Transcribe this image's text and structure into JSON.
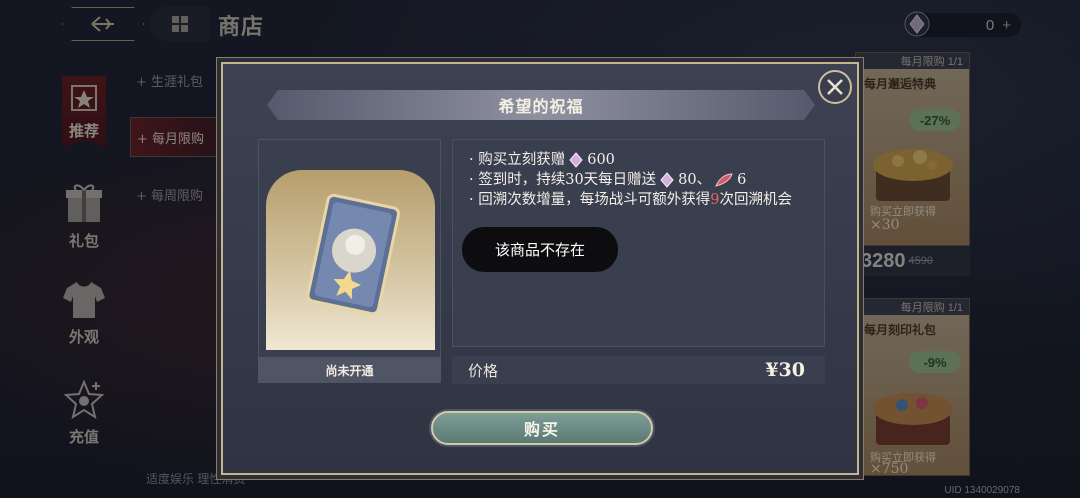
{
  "header": {
    "title": "商店",
    "currency_value": "0",
    "currency_plus": "+"
  },
  "nav": [
    {
      "label": "推荐"
    },
    {
      "label": "礼包"
    },
    {
      "label": "外观"
    },
    {
      "label": "充值"
    }
  ],
  "sub_tabs": [
    {
      "label": "+ 生涯礼包"
    },
    {
      "label": "+ 每月限购"
    },
    {
      "label": "+ 每周限购"
    }
  ],
  "products": [
    {
      "limit": "每月限购 1/1",
      "name": "每月邂逅特典",
      "discount": "-27%",
      "caption": "购买立即获得",
      "count": "×30",
      "price": "3280",
      "old_price": "4590"
    },
    {
      "limit": "每月限购 1/1",
      "name": "每月刻印礼包",
      "discount": "-9%",
      "caption": "购买立即获得",
      "count": "×750"
    }
  ],
  "footer_text": "适度娱乐 理性消费",
  "uid": "UID 1340029078",
  "modal": {
    "title": "希望的祝福",
    "card_status": "尚未开通",
    "desc": {
      "line1_a": "· 购买立刻获赠",
      "line1_b": "600",
      "line2_a": "· 签到时，持续30天每日赠送",
      "line2_b": "80、",
      "line2_c": "6",
      "line3_a": "· 回溯次数增量，每场战斗可额外获得",
      "line3_num": "9",
      "line3_b": "次回溯机会"
    },
    "price_label": "价格",
    "price_value": "¥30",
    "buy_label": "购买"
  },
  "toast": "该商品不存在",
  "colors": {
    "accent_gold": "#c8b48a",
    "buy_button": "#6b8c85",
    "highlight_red": "#e06a5c"
  }
}
